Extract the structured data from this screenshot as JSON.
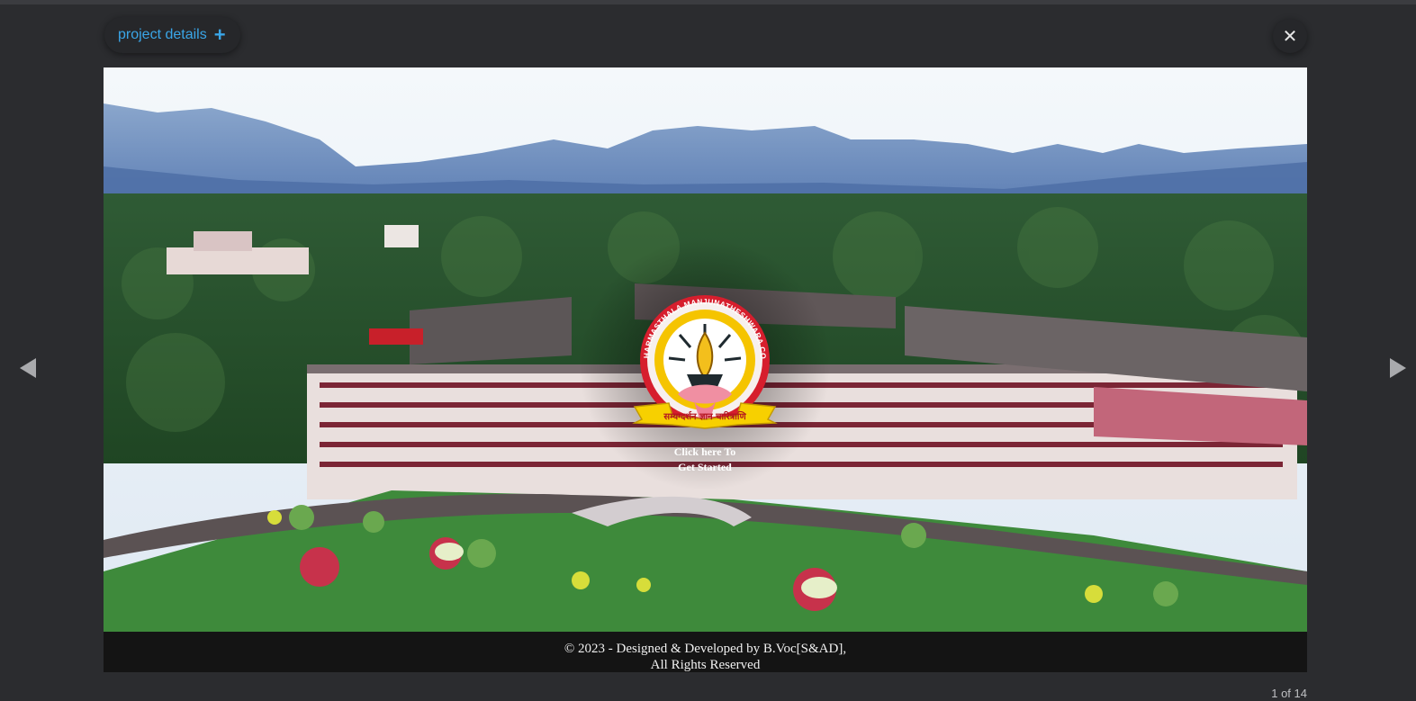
{
  "header": {
    "details_label": "project details",
    "plus_icon": "plus-icon",
    "close_icon": "close-icon",
    "close_glyph": "✕"
  },
  "navigation": {
    "prev_icon": "chevron-left-icon",
    "next_icon": "chevron-right-icon"
  },
  "slide": {
    "logo_text": "SHRI DHARMASTHALA MANJUNATHESHWARA COLLEGE",
    "banner_text": "सम्यग्दर्शन ज्ञान चारित्राणि",
    "cta_line1": "Click here To",
    "cta_line2": "Get Started",
    "footer_line1": "© 2023 - Designed & Developed by B.Voc[S&AD],",
    "footer_line2": "All Rights Reserved"
  },
  "counter": "1 of 14",
  "colors": {
    "accent": "#3aa6e8",
    "background": "#2b2c2f"
  }
}
